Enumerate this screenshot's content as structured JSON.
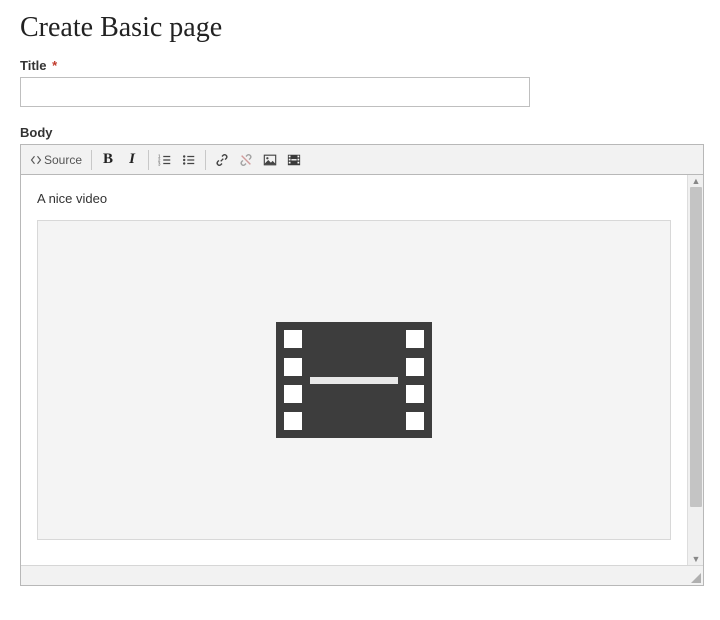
{
  "page": {
    "heading": "Create Basic page"
  },
  "titleField": {
    "label": "Title",
    "required": "*",
    "value": ""
  },
  "bodyField": {
    "label": "Body"
  },
  "toolbar": {
    "source_label": "Source"
  },
  "content": {
    "text": "A nice video"
  }
}
